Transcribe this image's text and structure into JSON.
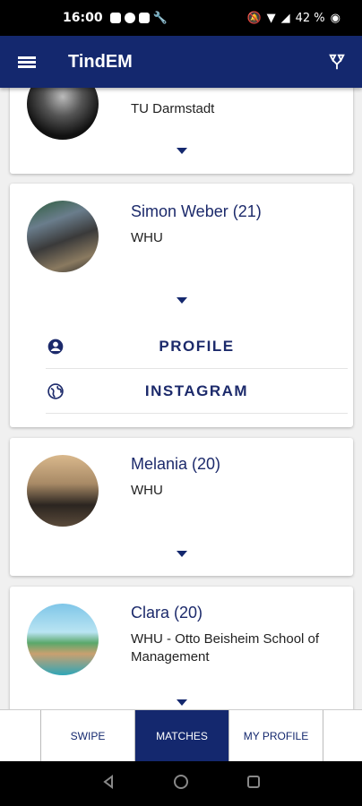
{
  "status_bar": {
    "time": "16:00",
    "battery": "42 %"
  },
  "app_bar": {
    "title": "TindEM"
  },
  "matches": [
    {
      "name": "",
      "university": "TU Darmstadt",
      "expanded": false
    },
    {
      "name": "Simon Weber (21)",
      "university": "WHU",
      "expanded": true,
      "actions": [
        {
          "label": "PROFILE",
          "icon": "account-circle-icon"
        },
        {
          "label": "INSTAGRAM",
          "icon": "globe-icon"
        }
      ]
    },
    {
      "name": "Melania (20)",
      "university": "WHU",
      "expanded": false
    },
    {
      "name": "Clara (20)",
      "university": "WHU - Otto Beisheim School of Management",
      "expanded": false
    }
  ],
  "bottom_nav": {
    "items": [
      {
        "label": "SWIPE"
      },
      {
        "label": "MATCHES",
        "active": true
      },
      {
        "label": "MY PROFILE"
      }
    ]
  },
  "colors": {
    "primary": "#14286e",
    "background": "#f0f0f0",
    "card": "#ffffff"
  }
}
